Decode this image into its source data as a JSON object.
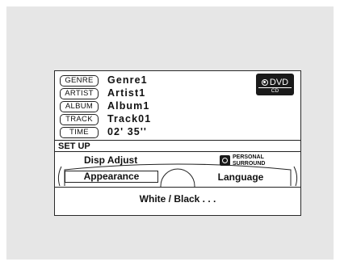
{
  "info": {
    "rows": [
      {
        "tag": "GENRE",
        "value": "Genre1"
      },
      {
        "tag": "ARTIST",
        "value": "Artist1"
      },
      {
        "tag": "ALBUM",
        "value": "Album1"
      },
      {
        "tag": "TRACK",
        "value": "Track01"
      },
      {
        "tag": "TIME",
        "value": "02' 35''"
      }
    ]
  },
  "source_badge": {
    "primary": "DVD",
    "secondary": "CD",
    "icon": "disc-icon"
  },
  "setup": {
    "title": "SET UP",
    "items": {
      "disp_adjust": "Disp Adjust",
      "personal_surround": [
        "PERSONAL",
        "SURROUND"
      ],
      "appearance": "Appearance",
      "language": "Language"
    },
    "selected": "appearance"
  },
  "status": {
    "text": "White / Black . . ."
  },
  "colors": {
    "background": "#e6e6e6",
    "screen": "#ffffff",
    "ink": "#111111"
  }
}
